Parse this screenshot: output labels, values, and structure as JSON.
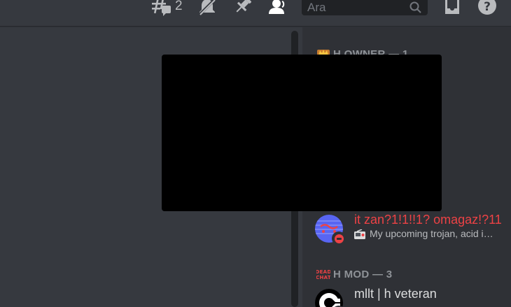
{
  "header": {
    "threads_count": "2",
    "search": {
      "placeholder": "Ara"
    },
    "icons": [
      "threads-icon",
      "mute-notifications-icon",
      "pinned-messages-icon",
      "member-list-icon",
      "inbox-icon",
      "help-icon"
    ]
  },
  "members": {
    "roles": [
      {
        "label": "H OWNER — 1",
        "icon": "crown-emoji-icon"
      },
      {
        "label": "H MOD — 3",
        "icon": "dead-chat-emoji-icon",
        "icon_text": "DEAD CHAT"
      }
    ],
    "items": [
      {
        "name": "it zan?1!1!!1? omagaz!?11",
        "name_color": "#ed4245",
        "status": "dnd",
        "activity": "My upcoming trojan, acid i…",
        "activity_icon": "radio-emoji-icon"
      },
      {
        "name": "mllt | h veteran",
        "name_color": "#dcddde",
        "status": "dnd",
        "activity": "",
        "avatar": "c-logo-avatar"
      }
    ]
  },
  "colors": {
    "chat_bg": "#36393f",
    "member_list_bg": "#2f3136",
    "search_bg": "#202225",
    "dnd_red": "#ed4245",
    "redaction": "#000000"
  }
}
